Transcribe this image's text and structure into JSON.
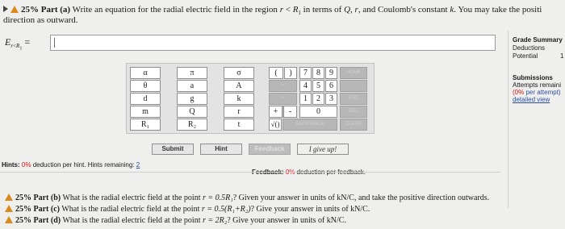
{
  "part_a": {
    "percent": "25%",
    "label": "Part (a)",
    "text_line1_prefix": "Write an equation for the radial electric field in the region",
    "var_r": "r",
    "lt": "<",
    "var_R": "R",
    "sub_1": "1",
    "text_line1_mid": "in terms of",
    "var_Q": "Q",
    "comma": ",",
    "text_line1_suffix": ", and Coulomb's constant",
    "var_k": "k",
    "text_line1_end": ". You may take the positi",
    "text_line2": "direction as outward."
  },
  "equation": {
    "E": "E",
    "sub_r": "r",
    "lt": "<",
    "R": "R",
    "one": "1",
    "eq": "=",
    "value": ""
  },
  "keypad": {
    "symbols": [
      [
        "α",
        "π",
        "σ"
      ],
      [
        "θ",
        "a",
        "A"
      ],
      [
        "d",
        "g",
        "k"
      ],
      [
        "m",
        "Q",
        "r"
      ],
      [
        "R₁",
        "R₂",
        "t"
      ]
    ],
    "paren_open": "(",
    "paren_close": ")",
    "digits": [
      [
        "7",
        "8",
        "9"
      ],
      [
        "4",
        "5",
        "6"
      ],
      [
        "1",
        "2",
        "3"
      ]
    ],
    "zero": "0",
    "plus": "+",
    "minus": "-",
    "sqrt": "√()",
    "home": "HOME",
    "end": "END",
    "backspace": "BACKSPACE",
    "del": "DEL",
    "clear": "CLEAR",
    "dis_row2": "÷",
    "dis_row3": "×",
    "dis_top1": "^",
    "dis_top2": "·"
  },
  "buttons": {
    "submit": "Submit",
    "hint": "Hint",
    "feedback": "Feedback",
    "give_up": "I give up!"
  },
  "hints_bar": {
    "label": "Hints:",
    "pct": "0%",
    "text": "deduction per hint. Hints remaining:",
    "remaining": "2"
  },
  "feedback_bar": {
    "label": "Feedback:",
    "pct": "0%",
    "text": "deduction per feedback."
  },
  "sidebar": {
    "grade_summary": "Grade Summary",
    "deductions": "Deductions",
    "potential": "Potential",
    "potential_value": "1",
    "submissions": "Submissions",
    "attempts_remaining": "Attempts remaini",
    "per_attempt_pct": "(0%",
    "per_attempt_text": "per attempt)",
    "detailed_view": "detailed view"
  },
  "parts": [
    {
      "percent": "25%",
      "label": "Part (b)",
      "text": "What is the radial electric field at the point",
      "math": "r = 0.5R₁",
      "rest": "? Given your answer in units of kN/C, and take the positive direction outwards."
    },
    {
      "percent": "25%",
      "label": "Part (c)",
      "text": "What is the radial electric field at the point",
      "math": "r = 0.5(R₁+R₂)",
      "rest": "? Give your answer in units of kN/C."
    },
    {
      "percent": "25%",
      "label": "Part (d)",
      "text": "What is the radial electric field at the point",
      "math": "r = 2R₂",
      "rest": "? Give your answer in units of kN/C."
    }
  ],
  "colors": {
    "warning": "#d88a1c",
    "pct_red": "#d11111",
    "link": "#2b4fa8"
  }
}
